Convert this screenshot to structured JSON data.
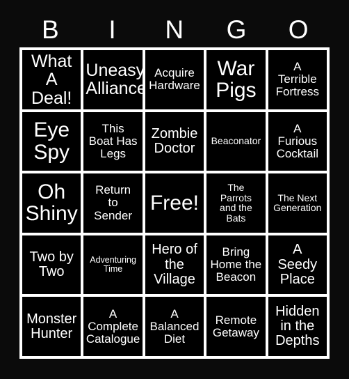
{
  "card": {
    "title": "BINGO",
    "header_letters": [
      "B",
      "I",
      "N",
      "G",
      "O"
    ],
    "colors": {
      "background": "#0b0b0b",
      "grid_line": "#ffffff",
      "cell_background": "#000000",
      "text": "#ffffff"
    },
    "grid_size": "5x5",
    "free_space_index": 12,
    "cells": [
      {
        "text": "What A\nDeal!",
        "size": "lg",
        "marked": false
      },
      {
        "text": "Uneasy\nAlliance",
        "size": "lg",
        "marked": false
      },
      {
        "text": "Acquire\nHardware",
        "size": "sm",
        "marked": false
      },
      {
        "text": "War\nPigs",
        "size": "xl",
        "marked": false
      },
      {
        "text": "A\nTerrible\nFortress",
        "size": "sm",
        "marked": false
      },
      {
        "text": "Eye\nSpy",
        "size": "xl",
        "marked": false
      },
      {
        "text": "This\nBoat Has\nLegs",
        "size": "sm",
        "marked": false
      },
      {
        "text": "Zombie\nDoctor",
        "size": "md",
        "marked": false
      },
      {
        "text": "Beaconator",
        "size": "xs",
        "marked": false
      },
      {
        "text": "A\nFurious\nCocktail",
        "size": "sm",
        "marked": false
      },
      {
        "text": "Oh\nShiny",
        "size": "xl",
        "marked": false
      },
      {
        "text": "Return\nto\nSender",
        "size": "sm",
        "marked": false
      },
      {
        "text": "Free!",
        "size": "xl",
        "marked": false
      },
      {
        "text": "The\nParrots\nand the\nBats",
        "size": "xs",
        "marked": false
      },
      {
        "text": "The Next\nGeneration",
        "size": "xs",
        "marked": false
      },
      {
        "text": "Two by\nTwo",
        "size": "md",
        "marked": false
      },
      {
        "text": "Adventuring\nTime",
        "size": "xxs",
        "marked": false
      },
      {
        "text": "Hero of\nthe\nVillage",
        "size": "md",
        "marked": false
      },
      {
        "text": "Bring\nHome the\nBeacon",
        "size": "sm",
        "marked": false
      },
      {
        "text": "A\nSeedy\nPlace",
        "size": "md",
        "marked": false
      },
      {
        "text": "Monster\nHunter",
        "size": "md",
        "marked": false
      },
      {
        "text": "A\nComplete\nCatalogue",
        "size": "sm",
        "marked": false
      },
      {
        "text": "A\nBalanced\nDiet",
        "size": "sm",
        "marked": false
      },
      {
        "text": "Remote\nGetaway",
        "size": "sm",
        "marked": false
      },
      {
        "text": "Hidden\nin the\nDepths",
        "size": "md",
        "marked": false
      }
    ]
  }
}
